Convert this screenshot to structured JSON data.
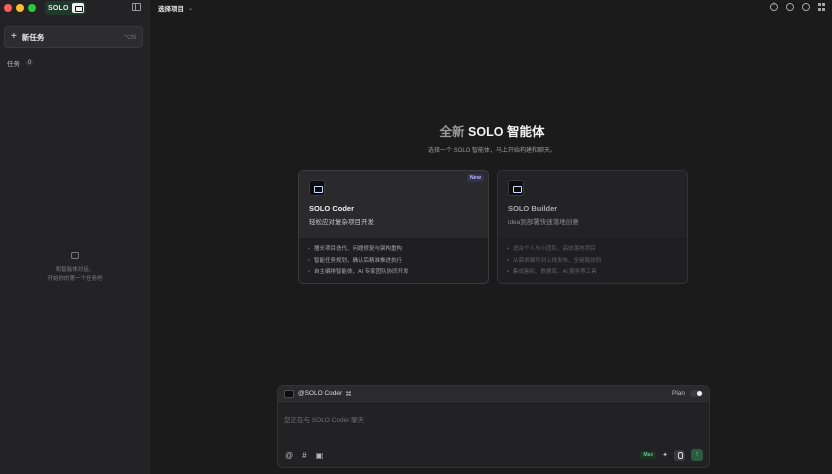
{
  "sidebar": {
    "brand": "SOLO",
    "new_task": {
      "label": "新任务",
      "shortcut": "⌥N"
    },
    "tasks": {
      "label": "任务",
      "count": "0"
    },
    "empty_state": {
      "line1": "和智能体对话，",
      "line2": "开始你的第一个任务吧"
    }
  },
  "topbar": {
    "project_label": "选择项目"
  },
  "hero": {
    "title_dim": "全新",
    "title_main": "SOLO 智能体",
    "subtitle": "选择一个 SOLO 智能体，马上开始构建和聊天。"
  },
  "cards": [
    {
      "name": "SOLO Coder",
      "desc": "轻松应对复杂项目开发",
      "badge": "New",
      "features": [
        "擅长项目迭代、问题修复与架构重构",
        "智能任务规划，确认后精准推进执行",
        "自主编排智能体，AI 专家团队协同开发"
      ]
    },
    {
      "name": "SOLO Builder",
      "desc": "idea到部署快速落地创意",
      "features": [
        "适合个人与小团队，高效落地项目",
        "从需求编写到上线发布，全链路协同",
        "集成鉴权、数据库、AI 服务等工具"
      ]
    }
  ],
  "composer": {
    "agent": "@SOLO Coder",
    "tools_icon": "⌘",
    "plan_label": "Plan",
    "placeholder": "您正在与 SOLO Coder 聊天",
    "max_label": "Max"
  },
  "colors": {
    "brand_green": "#1f3a2a",
    "accent": "#59c585",
    "badge_purple": "#b9b1ff"
  }
}
